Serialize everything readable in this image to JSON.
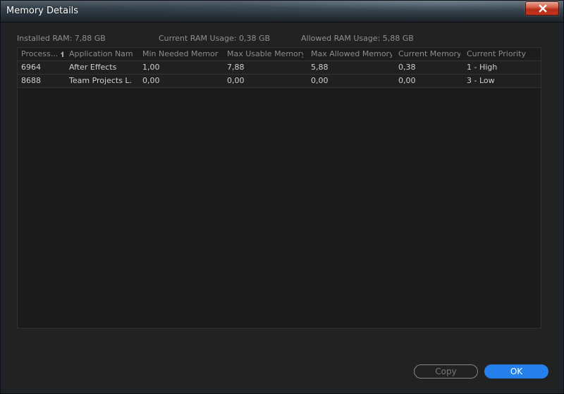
{
  "window": {
    "title": "Memory Details",
    "close_icon": "close-icon"
  },
  "summary": {
    "installed_ram": "Installed RAM: 7,88 GB",
    "current_ram_usage": "Current RAM Usage: 0,38 GB",
    "allowed_ram_usage": "Allowed RAM Usage: 5,88 GB"
  },
  "table": {
    "headers": [
      "Process...",
      "Application Name",
      "Min Needed Memory",
      "Max Usable Memory",
      "Max Allowed Memory",
      "Current Memory",
      "Current Priority"
    ],
    "sort_icon": "sort-up-icon",
    "rows": [
      [
        "6964",
        "After Effects",
        "1,00",
        "7,88",
        "5,88",
        "0,38",
        "1 - High"
      ],
      [
        "8688",
        "Team Projects L...",
        "0,00",
        "0,00",
        "0,00",
        "0,00",
        "3 - Low"
      ]
    ]
  },
  "buttons": {
    "copy": "Copy",
    "ok": "OK"
  },
  "colors": {
    "accent": "#2680eb",
    "close_button": "#c7341f",
    "background": "#222222",
    "header_text": "#8c8c8c",
    "cell_text": "#cfcfcf"
  }
}
